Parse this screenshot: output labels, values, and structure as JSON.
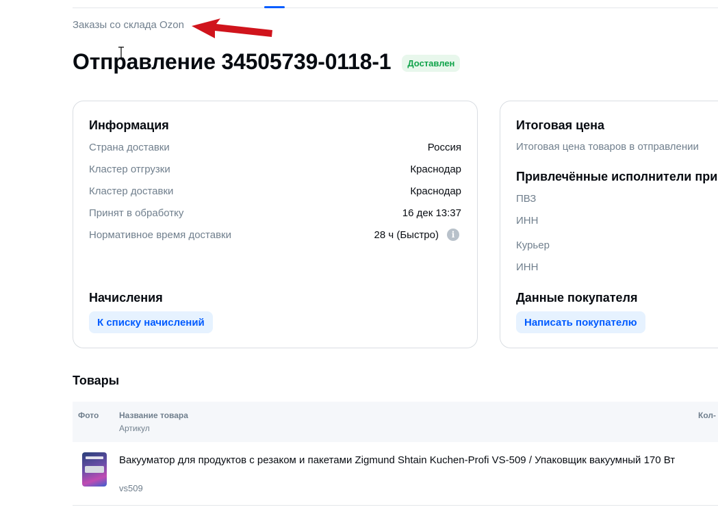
{
  "breadcrumb": "Заказы со склада Ozon",
  "header": {
    "title": "Отправление 34505739-0118-1",
    "status": "Доставлен"
  },
  "info": {
    "title": "Информация",
    "rows": [
      {
        "label": "Страна доставки",
        "value": "Россия"
      },
      {
        "label": "Кластер отгрузки",
        "value": "Краснодар"
      },
      {
        "label": "Кластер доставки",
        "value": "Краснодар"
      },
      {
        "label": "Принят в обработку",
        "value": "16 дек 13:37"
      },
      {
        "label": "Нормативное время доставки",
        "value": "28 ч (Быстро)"
      }
    ],
    "accruals_title": "Начисления",
    "accruals_button": "К списку начислений"
  },
  "price": {
    "title": "Итоговая цена",
    "subtitle": "Итоговая цена товаров в отправлении",
    "executors_title": "Привлечённые исполнители при",
    "pvz_label": "ПВЗ",
    "pvz_inn_label": "ИНН",
    "courier_label": "Курьер",
    "courier_inn_label": "ИНН",
    "buyer_title": "Данные покупателя",
    "buyer_button": "Написать покупателю"
  },
  "goods": {
    "title": "Товары",
    "columns": {
      "photo": "Фото",
      "name": "Название товара",
      "sku": "Артикул",
      "qty": "Кол-"
    },
    "items": [
      {
        "name": "Вакууматор для продуктов с резаком и пакетами Zigmund Shtain Kuchen-Profi VS-509 / Упаковщик вакуумный 170 Вт",
        "sku": "vs509"
      }
    ]
  },
  "colors": {
    "accent": "#005bff",
    "status_green": "#10a34a",
    "annotation_arrow": "#d0141c"
  }
}
